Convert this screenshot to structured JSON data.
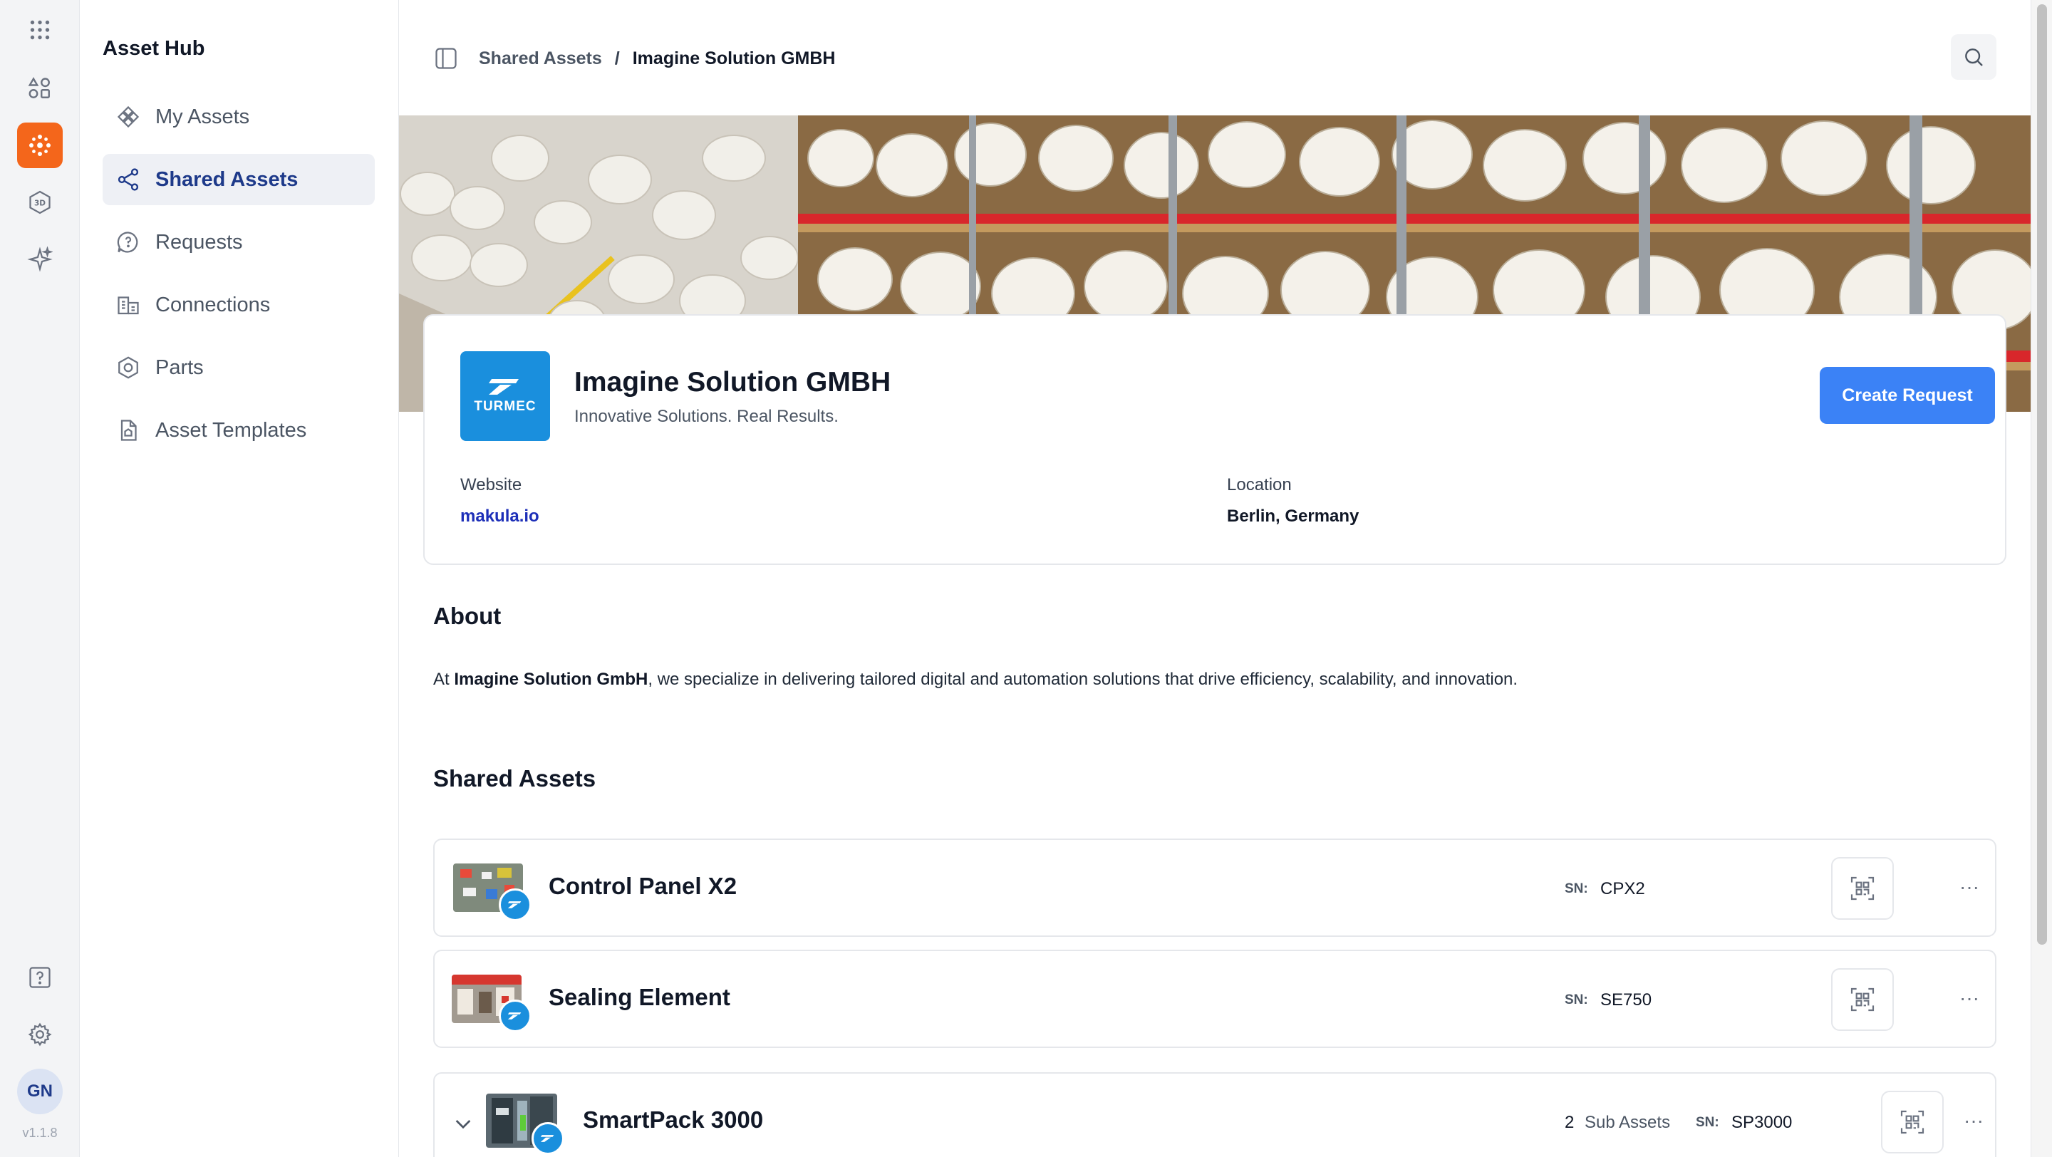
{
  "rail": {
    "items": [
      {
        "icon": "apps-grid-icon"
      },
      {
        "icon": "dashboard-icon"
      },
      {
        "icon": "asset-hub-icon",
        "active": true
      },
      {
        "icon": "3d-cube-icon"
      },
      {
        "icon": "ai-sparkle-icon"
      }
    ],
    "bottom": [
      {
        "icon": "help-icon"
      },
      {
        "icon": "settings-icon"
      }
    ],
    "avatar_initials": "GN",
    "version": "v1.1.8",
    "accent_color": "#f4661b"
  },
  "nav": {
    "title": "Asset Hub",
    "items": [
      {
        "label": "My Assets",
        "icon": "assets-icon"
      },
      {
        "label": "Shared Assets",
        "icon": "share-icon",
        "active": true
      },
      {
        "label": "Requests",
        "icon": "request-icon"
      },
      {
        "label": "Connections",
        "icon": "connections-icon"
      },
      {
        "label": "Parts",
        "icon": "parts-icon"
      },
      {
        "label": "Asset Templates",
        "icon": "template-icon"
      }
    ]
  },
  "header": {
    "breadcrumb": [
      "Shared Assets",
      "Imagine Solution GMBH"
    ],
    "separator": "/"
  },
  "company": {
    "logo_text": "TURMEC",
    "name": "Imagine Solution GMBH",
    "tagline": "Innovative Solutions. Real Results.",
    "create_request_label": "Create Request",
    "website_label": "Website",
    "website_value": "makula.io",
    "location_label": "Location",
    "location_value": "Berlin, Germany",
    "brand_color": "#1a8fdd",
    "button_color": "#3b82f6"
  },
  "about": {
    "heading": "About",
    "prefix": "At ",
    "bold": "Imagine Solution GmbH",
    "suffix": ", we specialize in delivering tailored digital and automation solutions that drive efficiency, scalability, and innovation."
  },
  "shared_assets": {
    "heading": "Shared Assets",
    "sn_label": "SN:",
    "items": [
      {
        "name": "Control Panel X2",
        "sn": "CPX2"
      },
      {
        "name": "Sealing Element",
        "sn": "SE750"
      },
      {
        "name": "SmartPack 3000",
        "sn": "SP3000",
        "sub_count": "2",
        "sub_label": "Sub Assets",
        "expandable": true
      }
    ]
  }
}
